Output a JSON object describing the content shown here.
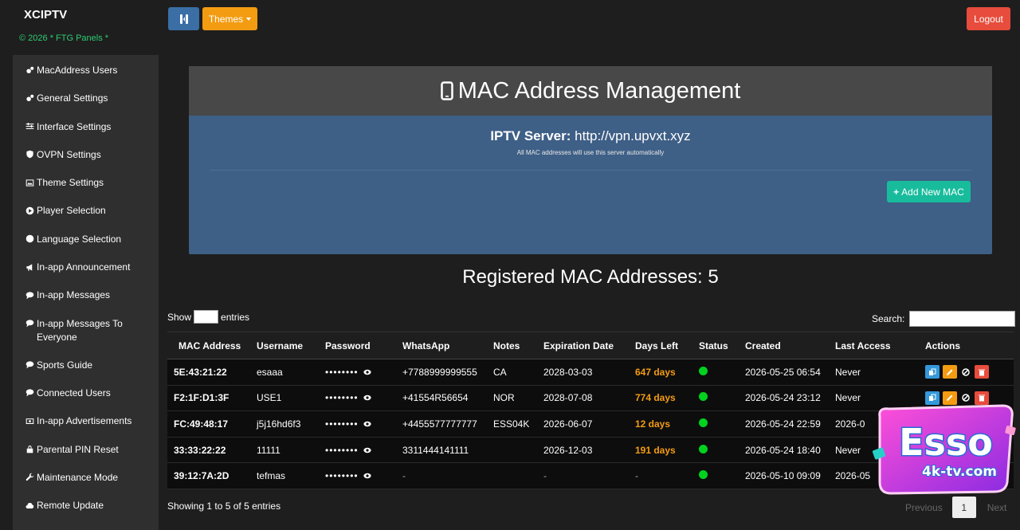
{
  "brand": {
    "title": "XCIPTV",
    "subtitle": "© 2026 * FTG Panels *"
  },
  "sidebar": {
    "items": [
      {
        "label": "MacAddress Users",
        "icon": "gears-icon"
      },
      {
        "label": "General Settings",
        "icon": "gears-icon"
      },
      {
        "label": "Interface Settings",
        "icon": "sliders-icon"
      },
      {
        "label": "OVPN Settings",
        "icon": "shield-icon"
      },
      {
        "label": "Theme Settings",
        "icon": "image-icon"
      },
      {
        "label": "Player Selection",
        "icon": "play-circle-icon"
      },
      {
        "label": "Language Selection",
        "icon": "globe-icon"
      },
      {
        "label": "In-app Announcement",
        "icon": "bullhorn-icon"
      },
      {
        "label": "In-app Messages",
        "icon": "comment-icon"
      },
      {
        "label": "In-app Messages To Everyone",
        "icon": "comment-icon"
      },
      {
        "label": "Sports Guide",
        "icon": "comment-icon"
      },
      {
        "label": "Connected Users",
        "icon": "comment-icon"
      },
      {
        "label": "In-app Advertisements",
        "icon": "ad-icon"
      },
      {
        "label": "Parental PIN Reset",
        "icon": "lock-icon"
      },
      {
        "label": "Maintenance Mode",
        "icon": "wrench-icon"
      },
      {
        "label": "Remote Update",
        "icon": "cloud-upload-icon"
      }
    ]
  },
  "topbar": {
    "themes_label": "Themes",
    "logout_label": "Logout"
  },
  "panel": {
    "title": "MAC Address Management",
    "server_label": "IPTV Server:",
    "server_url": "http://vpn.upvxt.xyz",
    "server_note": "All MAC addresses will use this server automatically",
    "add_button": "Add New MAC"
  },
  "registered": {
    "heading": "Registered MAC Addresses: 5"
  },
  "table_controls": {
    "show_label": "Show",
    "entries_label": "entries",
    "search_label": "Search:"
  },
  "table": {
    "headers": [
      "MAC Address",
      "Username",
      "Password",
      "WhatsApp",
      "Notes",
      "Expiration Date",
      "Days Left",
      "Status",
      "Created",
      "Last Access",
      "Actions"
    ],
    "rows": [
      {
        "mac": "5E:43:21:22",
        "username": "esaaa",
        "password": "••••••••",
        "whatsapp": "+7788999999555",
        "notes": "CA",
        "expiration": "2028-03-03",
        "days_left": "647 days",
        "created": "2026-05-25 06:54",
        "last_access": "Never"
      },
      {
        "mac": "F2:1F:D1:3F",
        "username": "USE1",
        "password": "••••••••",
        "whatsapp": "+41554R56654",
        "notes": "NOR",
        "expiration": "2028-07-08",
        "days_left": "774 days",
        "created": "2026-05-24 23:12",
        "last_access": "Never"
      },
      {
        "mac": "FC:49:48:17",
        "username": "j5j16hd6f3",
        "password": "••••••••",
        "whatsapp": "+4455577777777",
        "notes": "ESS04K",
        "expiration": "2026-06-07",
        "days_left": "12 days",
        "created": "2026-05-24 22:59",
        "last_access": "2026-0"
      },
      {
        "mac": "33:33:22:22",
        "username": "11111",
        "password": "••••••••",
        "whatsapp": "3311444141111",
        "notes": "",
        "expiration": "2026-12-03",
        "days_left": "191 days",
        "created": "2026-05-24 18:40",
        "last_access": "Never"
      },
      {
        "mac": "39:12:7A:2D",
        "username": "tefmas",
        "password": "••••••••",
        "whatsapp": "-",
        "notes": "",
        "expiration": "-",
        "days_left": "-",
        "created": "2026-05-10 09:09",
        "last_access": "2026-05"
      }
    ]
  },
  "footer": {
    "showing": "Showing 1 to 5 of 5 entries",
    "prev": "Previous",
    "page": "1",
    "next": "Next"
  },
  "watermark": {
    "line1": "Esso",
    "line2": "4k-tv.com"
  },
  "colors": {
    "accent_blue": "#3e5f86",
    "success": "#18bc9c",
    "warning": "#f39c12",
    "danger": "#e74c3c",
    "status_online": "#00d21f"
  }
}
